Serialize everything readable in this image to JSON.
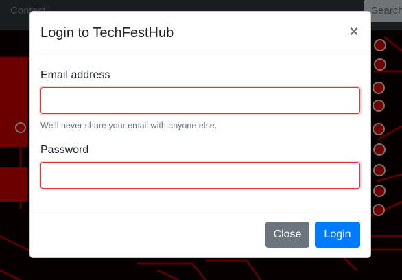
{
  "navbar": {
    "link_label": "Contact",
    "search_placeholder": "Search"
  },
  "modal": {
    "title": "Login to TechFestHub",
    "close_icon": "close-icon",
    "close_glyph": "×",
    "email": {
      "label": "Email address",
      "value": "",
      "placeholder": "",
      "help_text": "We'll never share your email with anyone else."
    },
    "password": {
      "label": "Password",
      "value": "",
      "placeholder": ""
    },
    "footer": {
      "close_label": "Close",
      "login_label": "Login"
    }
  },
  "colors": {
    "primary": "#007bff",
    "secondary": "#6c757d",
    "invalid_border": "#e3342f",
    "navbar": "#343a40",
    "background_circuit": "#cc0000"
  }
}
